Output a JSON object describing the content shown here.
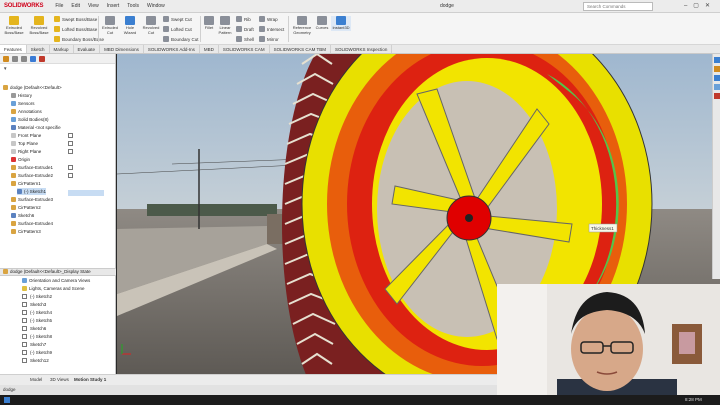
{
  "titlebar": {
    "logo": "SOLIDWORKS",
    "menu": [
      "File",
      "Edit",
      "View",
      "Insert",
      "Tools",
      "Window"
    ],
    "document": "dodge",
    "search_placeholder": "Search Commands"
  },
  "ribbon": {
    "big": [
      {
        "label1": "Extruded",
        "label2": "Boss/Base",
        "color": "#e4b51e"
      },
      {
        "label1": "Revolved",
        "label2": "Boss/Base",
        "color": "#e4b51e"
      },
      {
        "label1": "Hole",
        "label2": "Wizard",
        "color": "#3b7fd0"
      },
      {
        "label1": "Extruded",
        "label2": "Cut",
        "color": "#8a8f99"
      },
      {
        "label1": "Revolved",
        "label2": "Cut",
        "color": "#8a8f99"
      },
      {
        "label1": "Fillet",
        "label2": "",
        "color": "#8a8f99"
      },
      {
        "label1": "Linear",
        "label2": "Pattern",
        "color": "#8a8f99"
      },
      {
        "label1": "Reference",
        "label2": "Geometry",
        "color": "#8a8f99"
      },
      {
        "label1": "Curves",
        "label2": "",
        "color": "#8a8f99"
      },
      {
        "label1": "Instant3D",
        "label2": "",
        "color": "#3b7fd0"
      }
    ],
    "small_col1": [
      "Swept Boss/Base",
      "Lofted Boss/Base",
      "Boundary Boss/Base"
    ],
    "small_col2": [
      "Swept Cut",
      "Lofted Cut",
      "Boundary Cut"
    ],
    "small_col3": [
      "Rib",
      "Draft",
      "Shell"
    ],
    "small_col4": [
      "Wrap",
      "Intersect",
      "Mirror"
    ]
  },
  "tabs": [
    "Features",
    "Sketch",
    "Markup",
    "Evaluate",
    "MBD Dimensions",
    "SOLIDWORKS Add-Ins",
    "MBD",
    "SOLIDWORKS CAM",
    "SOLIDWORKS CAM TBM",
    "SOLIDWORKS Inspection"
  ],
  "tree_top": [
    "dodge  (Default<<Default>",
    "History",
    "Sensors",
    "Annotations",
    "Solid Bodies(8)",
    "Material <not specifie",
    "Front Plane",
    "Top Plane",
    "Right Plane",
    "Origin",
    "Surface-Extrude1",
    "Surface-Extrude2",
    "CirPattern1",
    "(-) Sketch1",
    "Surface-Extrude3",
    "CirPattern2",
    "Sketch6",
    "Surface-Extrude4",
    "CirPattern3"
  ],
  "tree_bottom": [
    "dodge  (Default<<Default>_Display State",
    "Orientation and Camera Views",
    "Lights, Cameras and Scene",
    "(-) Sketch2",
    "Sketch3",
    "(-) Sketch4",
    "(-) Sketch5",
    "Sketch6",
    "(-) Sketch8",
    "Sketch7",
    "(-) Sketch9",
    "Sketch12"
  ],
  "viewport": {
    "tooltip": "Thickness1"
  },
  "bottom_tabs": [
    "Model",
    "3D Views",
    "Motion Study 1"
  ],
  "status": "dodge",
  "taskbar_time": "8:28 PM"
}
